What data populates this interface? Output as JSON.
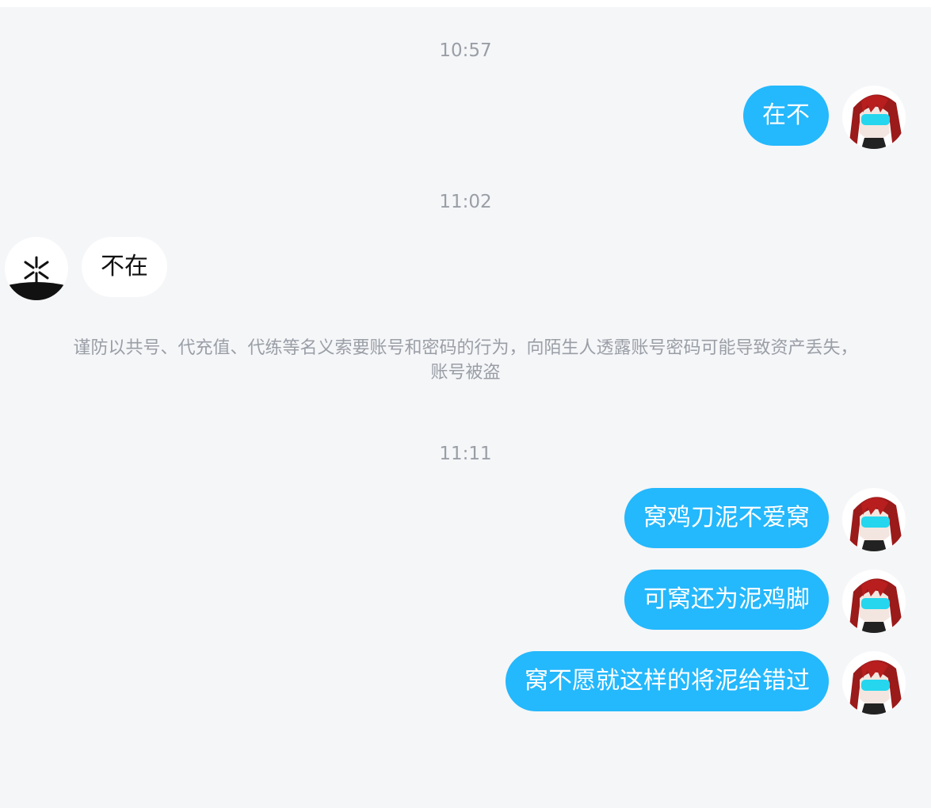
{
  "messages": [
    {
      "time": "10:57",
      "side": "out",
      "text": "在不"
    },
    {
      "time": "11:02",
      "side": "in",
      "text": "不在"
    },
    {
      "side": "out",
      "time": "11:11",
      "text": "窝鸡刀泥不爱窝"
    },
    {
      "side": "out",
      "text": "可窝还为泥鸡脚"
    },
    {
      "side": "out",
      "text": "窝不愿就这样的将泥给错过"
    }
  ],
  "timestamps": [
    "10:57",
    "11:02",
    "11:11"
  ],
  "notice": {
    "line1": "谨防以共号、代充值、代练等名义索要账号和密码的行为，向陌生人透露账号密码可能导致资产丢失，",
    "line2": "账号被盗"
  },
  "colors": {
    "background": "#f5f6f8",
    "outgoing_bubble": "#24b8fc",
    "incoming_bubble": "#ffffff",
    "timestamp_text": "#9a9ea6"
  },
  "icons": {
    "me_avatar": "anime-red-hair-avatar",
    "peer_avatar": "asterisk-flower-avatar"
  }
}
